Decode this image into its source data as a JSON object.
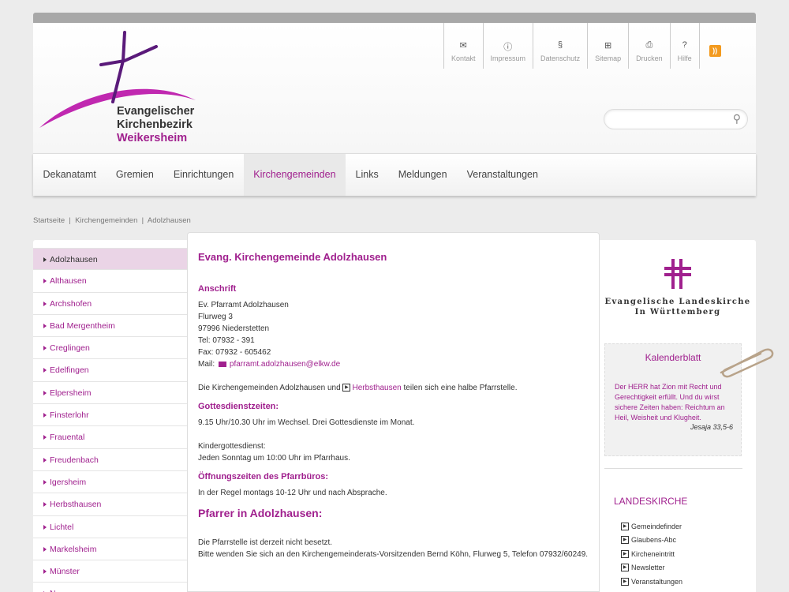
{
  "colors": {
    "accent": "#a0208e",
    "active_bg": "#ead4e6"
  },
  "logo": {
    "line1": "Evangelischer",
    "line2": "Kirchenbezirk",
    "line3": "Weikersheim"
  },
  "service": [
    {
      "label": "Kontakt",
      "icon": "envelope-icon"
    },
    {
      "label": "Impressum",
      "icon": "info-icon"
    },
    {
      "label": "Datenschutz",
      "icon": "paragraph-icon"
    },
    {
      "label": "Sitemap",
      "icon": "sitemap-icon"
    },
    {
      "label": "Drucken",
      "icon": "printer-icon"
    },
    {
      "label": "Hilfe",
      "icon": "help-icon"
    }
  ],
  "search": {
    "placeholder": ""
  },
  "nav": [
    "Dekanatamt",
    "Gremien",
    "Einrichtungen",
    "Kirchengemeinden",
    "Links",
    "Meldungen",
    "Veranstaltungen"
  ],
  "breadcrumb": "Startseite  |  Kirchengemeinden  |  Adolzhausen",
  "sidebar": [
    "Adolzhausen",
    "Althausen",
    "Archshofen",
    "Bad Mergentheim",
    "Creglingen",
    "Edelfingen",
    "Elpersheim",
    "Finsterlohr",
    "Frauental",
    "Freudenbach",
    "Igersheim",
    "Herbsthausen",
    "Lichtel",
    "Markelsheim",
    "Münster",
    "N..."
  ],
  "main": {
    "title": "Evang. Kirchengemeinde Adolzhausen",
    "anschrift_h": "Anschrift",
    "addr1": "Ev. Pfarramt Adolzhausen",
    "addr2": "Flurweg 3",
    "addr3": "97996 Niederstetten",
    "tel": "Tel: 07932 - 391",
    "fax": "Fax: 07932 - 605462",
    "mail_label": "Mail:",
    "mail": "pfarramt.adolzhausen@elkw.de",
    "share_pre": "Die Kirchengemeinden Adolzhausen und",
    "share_link": "Herbsthausen",
    "share_post": "teilen sich eine halbe Pfarrstelle.",
    "gd_h": "Gottesdienstzeiten:",
    "gd_text": "9.15 Uhr/10.30 Uhr im Wechsel. Drei Gottesdienste im Monat.",
    "kgd_1": "Kindergottesdienst:",
    "kgd_2": "Jeden Sonntag um 10:00 Uhr im Pfarrhaus.",
    "oz_h": "Öffnungszeiten des Pfarrbüros:",
    "oz_text": "In der Regel montags 10-12 Uhr und nach Absprache.",
    "pf_h": "Pfarrer in Adolzhausen:",
    "pf_1": "Die Pfarrstelle ist derzeit nicht besetzt.",
    "pf_2": "Bitte wenden Sie sich an den Kirchengemeinderats-Vorsitzenden Bernd Köhn, Flurweg 5, Telefon 07932/60249."
  },
  "right": {
    "elk_1": "Evangelische Landeskirche",
    "elk_2": "In Württemberg",
    "kal_title": "Kalenderblatt",
    "kal_text": "Der HERR hat Zion mit Recht und Gerechtigkeit erfüllt. Und du wirst sichere Zeiten haben: Reichtum an Heil, Weisheit und Klugheit.",
    "kal_src": "Jesaja 33,5-6",
    "lk_title": "LANDESKIRCHE",
    "links": [
      "Gemeindefinder",
      "Glaubens-Abc",
      "Kircheneintritt",
      "Newsletter",
      "Veranstaltungen"
    ]
  }
}
